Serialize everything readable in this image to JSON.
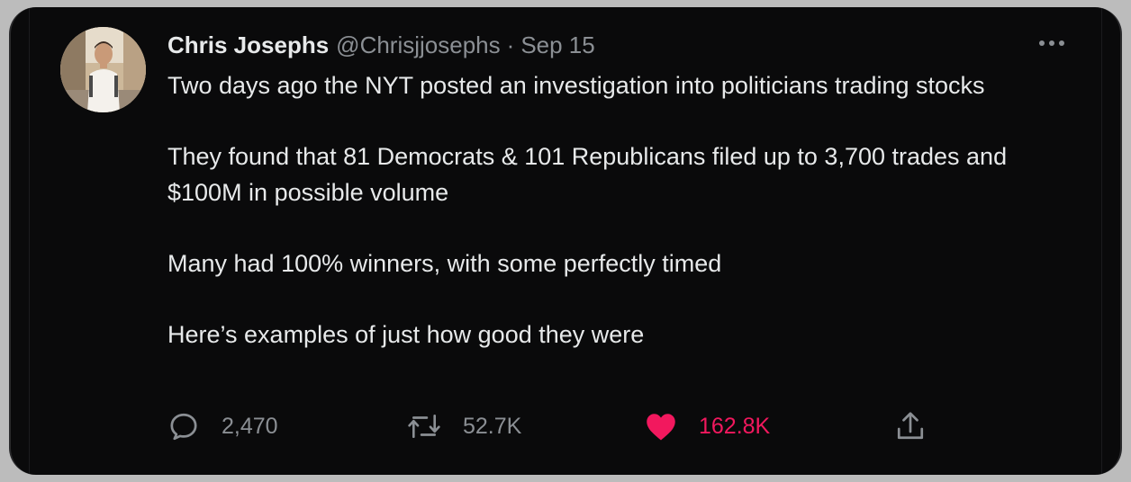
{
  "tweet": {
    "author_name": "Chris Josephs",
    "author_handle": "@Chrisjjosephs",
    "separator": "·",
    "date": "Sep 15",
    "paragraphs": [
      "Two days ago the NYT posted an investigation into politicians trading stocks",
      "They found that 81 Democrats & 101 Republicans filed up to 3,700 trades and $100M in possible volume",
      "Many had 100% winners, with some perfectly timed",
      "Here’s examples of just how good they were"
    ]
  },
  "actions": {
    "reply": {
      "icon": "reply-icon",
      "count": "2,470"
    },
    "retweet": {
      "icon": "retweet-icon",
      "count": "52.7K"
    },
    "like": {
      "icon": "heart-icon",
      "count": "162.8K",
      "liked": true
    },
    "share": {
      "icon": "share-icon"
    }
  },
  "colors": {
    "background": "#0a0a0b",
    "text_primary": "#e7e9ea",
    "text_secondary": "#8b8f94",
    "like_pink": "#f2185e"
  }
}
